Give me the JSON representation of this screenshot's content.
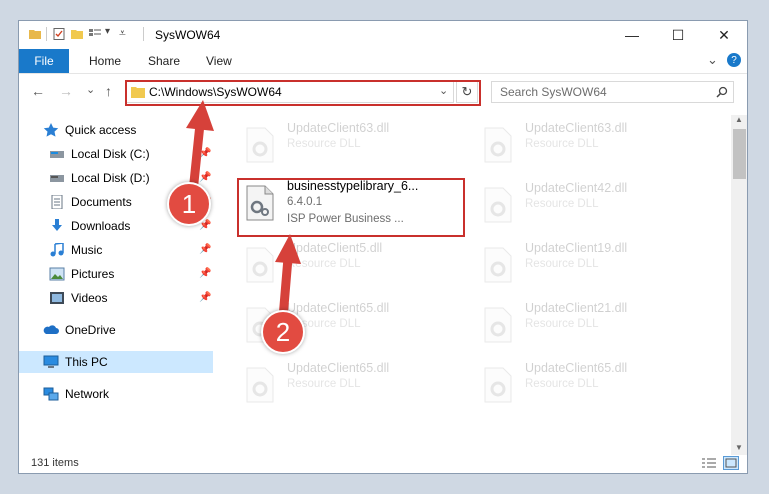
{
  "window": {
    "title": "SysWOW64",
    "controls": {
      "minimize": "—",
      "maximize": "☐",
      "close": "✕"
    }
  },
  "ribbon": {
    "tabs": [
      "File",
      "Home",
      "Share",
      "View"
    ],
    "expand": "⌄",
    "help": "?"
  },
  "address_bar": {
    "back": "←",
    "forward": "→",
    "recent": "⌄",
    "up": "↑",
    "path": "C:\\Windows\\SysWOW64",
    "dropdown": "⌄",
    "refresh": "↻"
  },
  "search": {
    "placeholder": "Search SysWOW64",
    "icon": "search-icon"
  },
  "sidebar": {
    "items": [
      {
        "label": "Quick access",
        "icon": "star-icon",
        "pinned": false
      },
      {
        "label": "Local Disk (C:)",
        "icon": "drive-icon",
        "pinned": true
      },
      {
        "label": "Local Disk (D:)",
        "icon": "drive-icon",
        "pinned": true
      },
      {
        "label": "Documents",
        "icon": "documents-icon",
        "pinned": true
      },
      {
        "label": "Downloads",
        "icon": "download-icon",
        "pinned": true
      },
      {
        "label": "Music",
        "icon": "music-icon",
        "pinned": true
      },
      {
        "label": "Pictures",
        "icon": "pictures-icon",
        "pinned": true
      },
      {
        "label": "Videos",
        "icon": "videos-icon",
        "pinned": true
      },
      {
        "label": "OneDrive",
        "icon": "cloud-icon",
        "pinned": false
      },
      {
        "label": "This PC",
        "icon": "computer-icon",
        "pinned": false,
        "selected": true
      },
      {
        "label": "Network",
        "icon": "network-icon",
        "pinned": false
      }
    ],
    "pin_glyph": "📌"
  },
  "files": {
    "highlighted": {
      "name": "businesstypelibrary_6...",
      "version": "6.4.0.1",
      "description": "ISP Power Business ..."
    },
    "faded": [
      {
        "name": "UpdateClient63.dll",
        "type": "Resource DLL"
      },
      {
        "name": "UpdateClient63.dll",
        "type": "Resource DLL"
      },
      {
        "name": "UpdateClient42.dll",
        "type": "Resource DLL"
      },
      {
        "name": "UpdateClient5.dll",
        "type": "Resource DLL"
      },
      {
        "name": "UpdateClient19.dll",
        "type": "Resource DLL"
      },
      {
        "name": "UpdateClient65.dll",
        "type": "Resource DLL"
      },
      {
        "name": "UpdateClient21.dll",
        "type": "Resource DLL"
      },
      {
        "name": "UpdateClient65.dll",
        "type": "Resource DLL"
      },
      {
        "name": "UpdateClient65.dll",
        "type": "Resource DLL"
      }
    ]
  },
  "status": {
    "item_count": "131 items"
  },
  "annotations": {
    "step1": "1",
    "step2": "2"
  },
  "colors": {
    "accent": "#1979ca",
    "highlight": "#c9302c",
    "badge": "#e24b41",
    "selected": "#cce8ff"
  }
}
